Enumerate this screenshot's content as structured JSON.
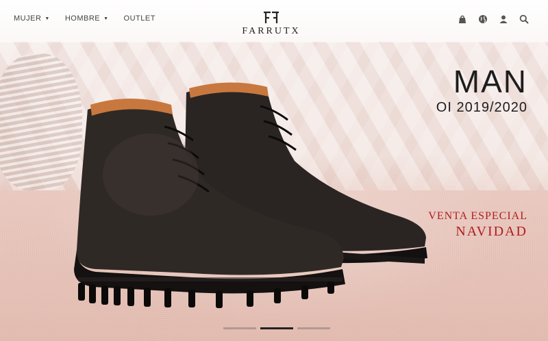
{
  "header": {
    "nav": [
      {
        "label": "MUJER",
        "has_dropdown": true
      },
      {
        "label": "HOMBRE",
        "has_dropdown": true
      },
      {
        "label": "OUTLET",
        "has_dropdown": false
      }
    ],
    "logo_text": "FARRUTX",
    "icons": [
      "bag-icon",
      "globe-icon",
      "user-icon",
      "search-icon"
    ]
  },
  "hero": {
    "title": "MAN",
    "subtitle": "OI 2019/2020",
    "promo_line_1": "VENTA ESPECIAL",
    "promo_line_2": "NAVIDAD",
    "slides_total": 3,
    "active_slide": 2
  },
  "colors": {
    "promo": "#b01c1c",
    "text": "#1d1d1d",
    "background": "#f1e3de"
  }
}
